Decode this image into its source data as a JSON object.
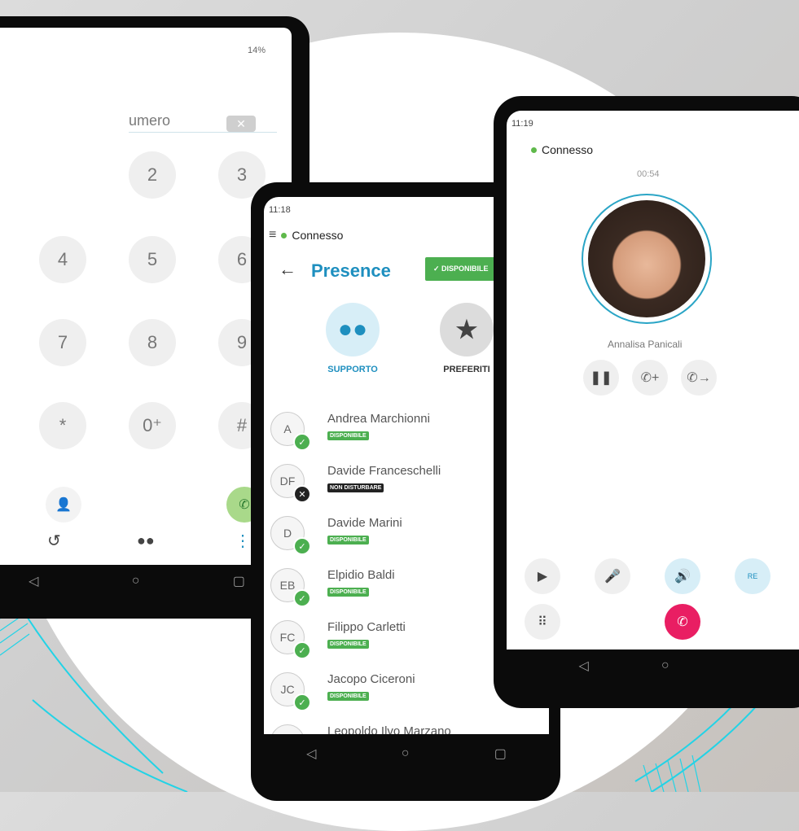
{
  "dialer": {
    "status": "14%",
    "number_placeholder": "umero",
    "keys": [
      {
        "digit": "2"
      },
      {
        "digit": "3"
      },
      {
        "digit": "4"
      },
      {
        "digit": "5"
      },
      {
        "digit": "6"
      },
      {
        "digit": "7"
      },
      {
        "digit": "8"
      },
      {
        "digit": "9"
      },
      {
        "digit": "*"
      },
      {
        "digit": "0⁺"
      },
      {
        "digit": "#"
      }
    ]
  },
  "presence": {
    "time": "11:18",
    "connection": "Connesso",
    "title": "Presence",
    "status_button": "DISPONIBILE",
    "tabs": [
      {
        "label": "SUPPORTO",
        "icon": "people-icon"
      },
      {
        "label": "PREFERITI",
        "icon": "star-icon"
      }
    ],
    "contacts": [
      {
        "initials": "A",
        "name": "Andrea Marchionni",
        "status": "DISPONIBILE"
      },
      {
        "initials": "DF",
        "name": "Davide Franceschelli",
        "status": "NON DISTURBARE"
      },
      {
        "initials": "D",
        "name": "Davide Marini",
        "status": "DISPONIBILE"
      },
      {
        "initials": "EB",
        "name": "Elpidio Baldi",
        "status": "DISPONIBILE"
      },
      {
        "initials": "FC",
        "name": "Filippo Carletti",
        "status": "DISPONIBILE"
      },
      {
        "initials": "JC",
        "name": "Jacopo Ciceroni",
        "status": "DISPONIBILE"
      },
      {
        "initials": "L",
        "name": "Leopoldo Ilvo Marzano",
        "status": ""
      }
    ]
  },
  "call": {
    "time": "11:19",
    "connection": "Connesso",
    "duration": "00:54",
    "caller": "Annalisa Panicali",
    "rec_label": "RE"
  },
  "colors": {
    "accent": "#1e8fbf",
    "available": "#4caf50",
    "dnd": "#222222",
    "hangup": "#e91e63",
    "cyan_deco": "#22d3e6"
  }
}
